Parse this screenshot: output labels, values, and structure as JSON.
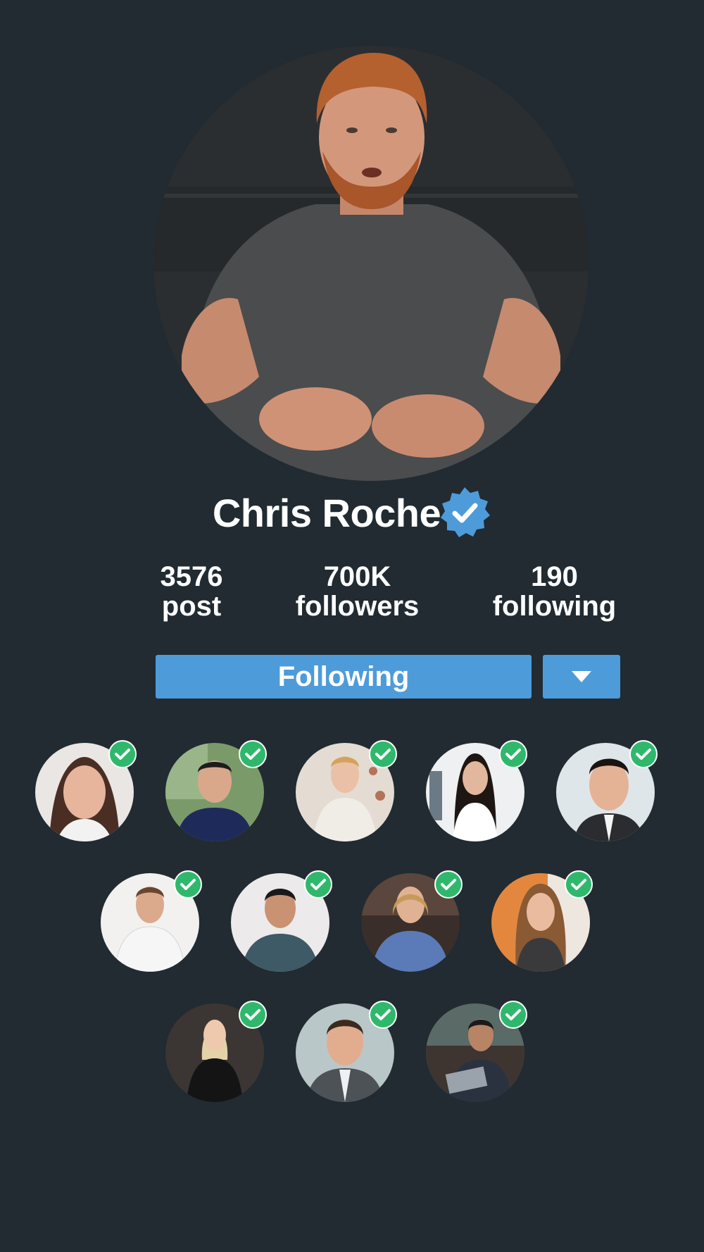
{
  "profile": {
    "name": "Chris Roche",
    "verified_icon": "verified-badge-icon",
    "verified_color": "#4e9bd9"
  },
  "stats": [
    {
      "value": "3576",
      "label": "post"
    },
    {
      "value": "700K",
      "label": "followers"
    },
    {
      "value": "190",
      "label": "following"
    }
  ],
  "actions": {
    "follow_label": "Following",
    "dropdown_icon": "caret-down-icon",
    "button_color": "#4e9bd9"
  },
  "followed_accounts": {
    "check_icon": "check-circle-icon",
    "check_color": "#2fb86c",
    "count_rows": [
      5,
      4,
      3
    ]
  },
  "colors": {
    "background": "#212b31"
  }
}
